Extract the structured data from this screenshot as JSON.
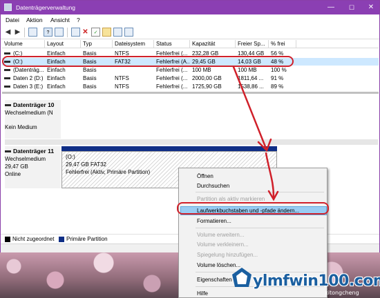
{
  "window": {
    "title": "Datenträgerverwaltung",
    "min": "—",
    "max": "☐",
    "close": "✕"
  },
  "menu": [
    "Datei",
    "Aktion",
    "Ansicht",
    "?"
  ],
  "columns": [
    "Volume",
    "Layout",
    "Typ",
    "Dateisystem",
    "Status",
    "Kapazität",
    "Freier Sp...",
    "% frei"
  ],
  "volumes": [
    [
      "(C:)",
      "Einfach",
      "Basis",
      "NTFS",
      "Fehlerfrei (...",
      "232,28 GB",
      "130,44 GB",
      "56 %"
    ],
    [
      "(O:)",
      "Einfach",
      "Basis",
      "FAT32",
      "Fehlerfrei (A...",
      "29,45 GB",
      "14,03 GB",
      "48 %"
    ],
    [
      "(Datenträg...",
      "Einfach",
      "Basis",
      "",
      "Fehlerfrei (...",
      "100 MB",
      "100 MB",
      "100 %"
    ],
    [
      "Daten 2 (D:)",
      "Einfach",
      "Basis",
      "NTFS",
      "Fehlerfrei (...",
      "2000,00 GB",
      "1811,64 ...",
      "91 %"
    ],
    [
      "Daten 3 (E:)",
      "Einfach",
      "Basis",
      "NTFS",
      "Fehlerfrei (...",
      "1725,90 GB",
      "1538,86 ...",
      "89 %"
    ]
  ],
  "disk10": {
    "name": "Datenträger 10",
    "type": "Wechselmedium (N",
    "status": "Kein Medium"
  },
  "disk11": {
    "name": "Datenträger 11",
    "type": "Wechselmedium",
    "size": "29,47 GB",
    "status": "Online"
  },
  "partition": {
    "letter": "(O:)",
    "size": "29,47 GB FAT32",
    "status": "Fehlerfrei (Aktiv, Primäre Partition)"
  },
  "legend": {
    "unallocated": "Nicht zugeordnet",
    "primary": "Primäre Partition"
  },
  "context_menu": {
    "open": "Öffnen",
    "browse": "Durchsuchen",
    "mark_active": "Partition als aktiv markieren",
    "change_letter": "Laufwerkbuchstaben und -pfade ändern...",
    "format": "Formatieren...",
    "extend": "Volume erweitern...",
    "shrink": "Volume verkleinern...",
    "add_mirror": "Spiegelung hinzufügen...",
    "delete": "Volume löschen...",
    "properties": "Eigenschaften",
    "help": "Hilfe"
  },
  "watermark": {
    "brand": "ylmfwin100.com",
    "sub": "xitongcheng"
  },
  "colors": {
    "titlebar": "#8b3fb3",
    "primary_partition": "#0f2e86",
    "highlight": "#d0202a",
    "menu_hover": "#99ccf3"
  }
}
